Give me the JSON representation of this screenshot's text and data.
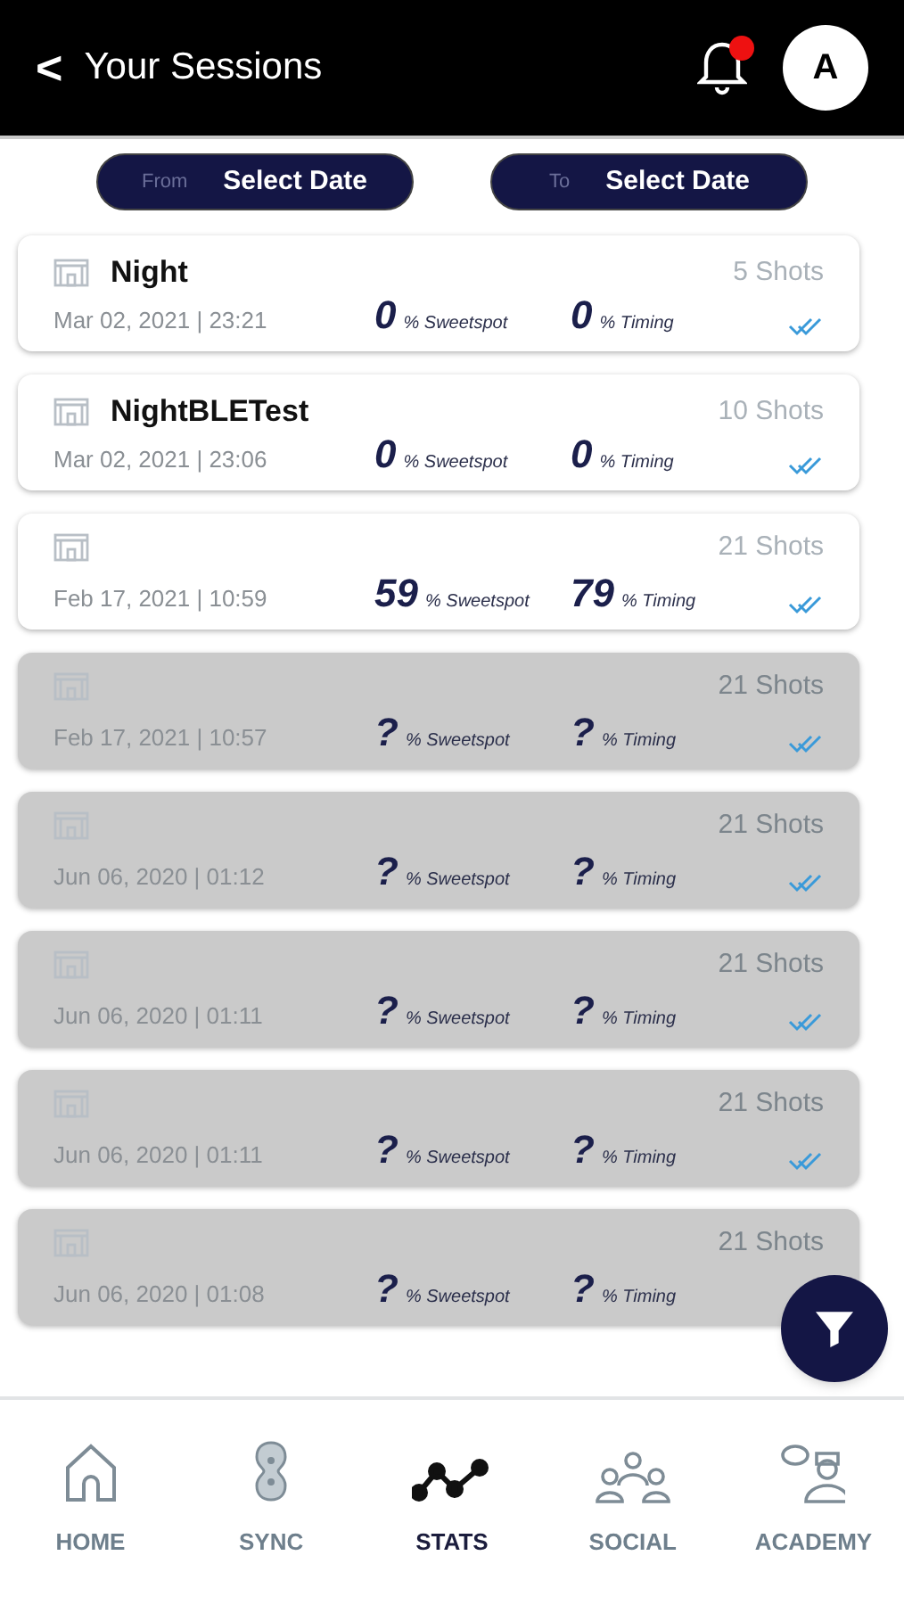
{
  "header": {
    "back": "<",
    "title": "Your Sessions",
    "notification_dot": true,
    "avatar": "A"
  },
  "date_filters": [
    {
      "prefix": "From",
      "value": "Select Date"
    },
    {
      "prefix": "To",
      "value": "Select Date"
    }
  ],
  "sessions": [
    {
      "name": "Night",
      "date": "Mar 02, 2021 | 23:21",
      "shots": "5 Shots",
      "sweetspot": "0",
      "sweetspot_label": "% Sweetspot",
      "timing": "0",
      "timing_label": "% Timing",
      "greyed": false,
      "synced": true
    },
    {
      "name": "NightBLETest",
      "date": "Mar 02, 2021 | 23:06",
      "shots": "10 Shots",
      "sweetspot": "0",
      "sweetspot_label": "% Sweetspot",
      "timing": "0",
      "timing_label": "% Timing",
      "greyed": false,
      "synced": true
    },
    {
      "date": "Feb 17, 2021 | 10:59",
      "shots": "21 Shots",
      "sweetspot": "59",
      "sweetspot_label": "% Sweetspot",
      "timing": "79",
      "timing_label": "% Timing",
      "greyed": false,
      "synced": true
    },
    {
      "date": "Feb 17, 2021 | 10:57",
      "shots": "21 Shots",
      "sweetspot": "?",
      "sweetspot_label": "% Sweetspot",
      "timing": "?",
      "timing_label": "% Timing",
      "greyed": true,
      "synced": true
    },
    {
      "date": "Jun 06, 2020 | 01:12",
      "shots": "21 Shots",
      "sweetspot": "?",
      "sweetspot_label": "% Sweetspot",
      "timing": "?",
      "timing_label": "% Timing",
      "greyed": true,
      "synced": true
    },
    {
      "date": "Jun 06, 2020 | 01:11",
      "shots": "21 Shots",
      "sweetspot": "?",
      "sweetspot_label": "% Sweetspot",
      "timing": "?",
      "timing_label": "% Timing",
      "greyed": true,
      "synced": true
    },
    {
      "date": "Jun 06, 2020 | 01:11",
      "shots": "21 Shots",
      "sweetspot": "?",
      "sweetspot_label": "% Sweetspot",
      "timing": "?",
      "timing_label": "% Timing",
      "greyed": true,
      "synced": true
    },
    {
      "date": "Jun 06, 2020 | 01:08",
      "shots": "21 Shots",
      "sweetspot": "?",
      "sweetspot_label": "% Sweetspot",
      "timing": "?",
      "timing_label": "% Timing",
      "greyed": true
    }
  ],
  "bottom_nav": [
    {
      "kind": "home",
      "label": "HOME",
      "selected": false
    },
    {
      "kind": "sync",
      "label": "SYNC",
      "selected": false
    },
    {
      "kind": "stats",
      "label": "STATS",
      "selected": true
    },
    {
      "kind": "social",
      "label": "SOCIAL",
      "selected": false
    },
    {
      "kind": "academy",
      "label": "ACADEMY",
      "selected": false
    }
  ]
}
